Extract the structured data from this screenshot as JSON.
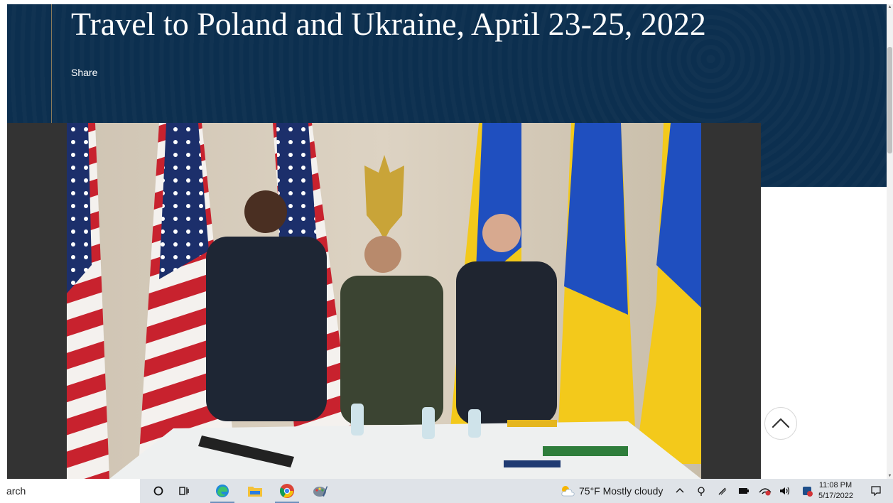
{
  "page": {
    "title": "Travel to Poland and Ukraine, April 23-25, 2022",
    "share_label": "Share"
  },
  "photo": {
    "alt": "Officials standing in front of U.S. and Ukrainian flags at a meeting table"
  },
  "taskbar": {
    "search_text": "arch",
    "weather_temp": "75°F",
    "weather_desc": "Mostly cloudy",
    "time": "11:08 PM",
    "date": "5/17/2022"
  },
  "colors": {
    "hero_bg": "#0c2f4f",
    "accent_line": "#8a7a5a",
    "taskbar_bg": "#dfe3e8"
  }
}
